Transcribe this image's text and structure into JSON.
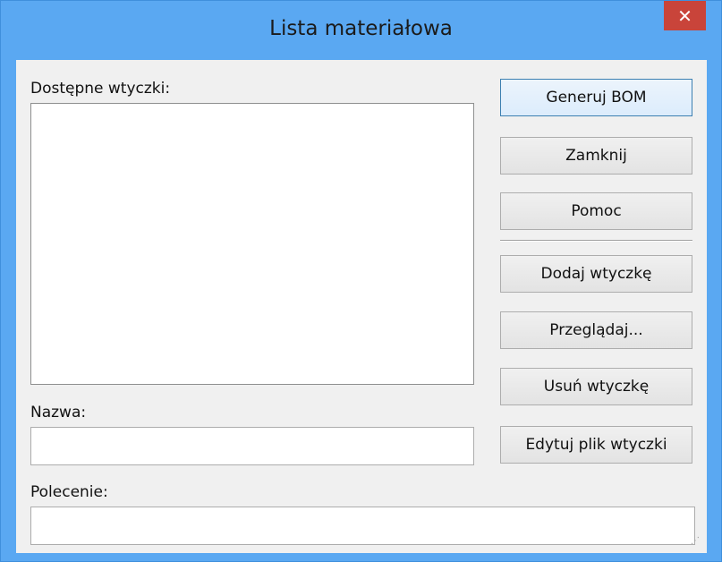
{
  "window": {
    "title": "Lista materiałowa",
    "close_label": "✕"
  },
  "plugins": {
    "label": "Dostępne wtyczki:",
    "items": []
  },
  "name": {
    "label": "Nazwa:",
    "value": ""
  },
  "command": {
    "label": "Polecenie:",
    "value": ""
  },
  "buttons": {
    "generate": "Generuj BOM",
    "close": "Zamknij",
    "help": "Pomoc",
    "add_plugin": "Dodaj wtyczkę",
    "browse": "Przeglądaj...",
    "remove_plugin": "Usuń wtyczkę",
    "edit_plugin_file": "Edytuj plik wtyczki"
  },
  "colors": {
    "titlebar": "#5aa8f2",
    "close_button": "#c9443a",
    "client_background": "#f0f0f0"
  }
}
